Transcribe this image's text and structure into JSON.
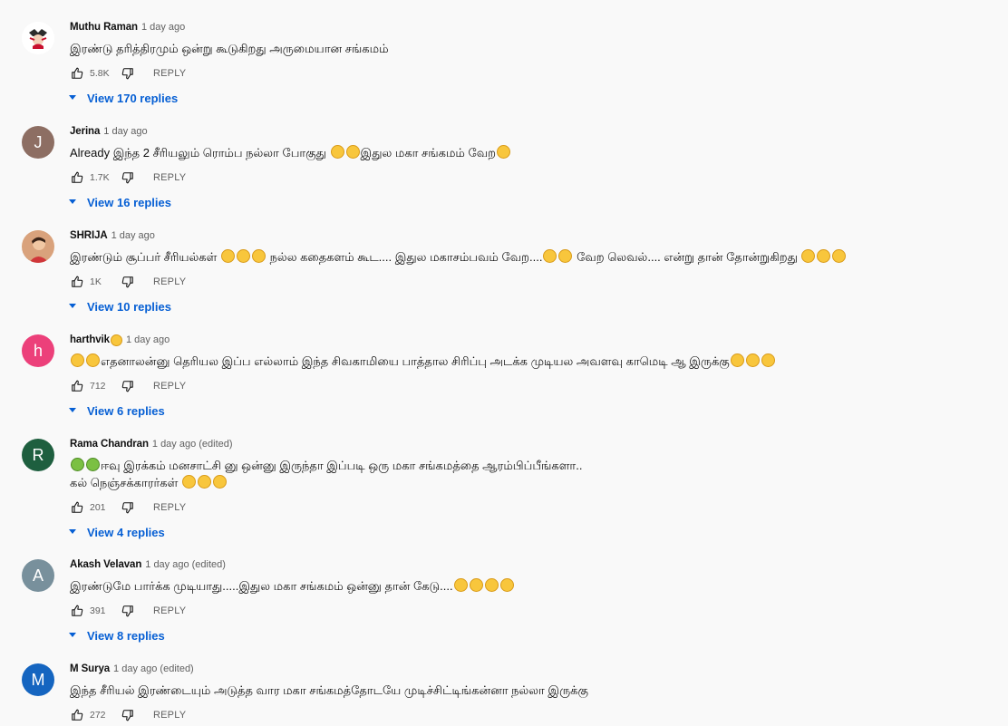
{
  "colors": {
    "background": "#f9f9f9",
    "link_blue": "#065fd4",
    "secondary_text": "#606060"
  },
  "comments": [
    {
      "author": "Muthu Raman",
      "time": "1 day ago",
      "avatar": {
        "type": "photo",
        "letter": ""
      },
      "text_line_1": "இரண்டு தரித்திரமும் ஒன்று கூடுகிறது அருமையான சங்கமம்",
      "likes": "5.8K",
      "reply_label": "REPLY",
      "replies_label": "View 170 replies"
    },
    {
      "author": "Jerina",
      "time": "1 day ago",
      "avatar": {
        "type": "letter",
        "letter": "J",
        "color": "#8d6e63"
      },
      "text_line_1": "Already இந்த 2 சீரியலும் ரொம்ப நல்லா போகுது",
      "text_line_1_b": "இதுல மகா சங்கமம் வேற",
      "likes": "1.7K",
      "reply_label": "REPLY",
      "replies_label": "View 16 replies"
    },
    {
      "author": "SHRIJA",
      "time": "1 day ago",
      "avatar": {
        "type": "photo",
        "letter": ""
      },
      "text_line_1": "இரண்டும் சூப்பர் சீரியல்கள்",
      "text_line_1_b": "நல்ல கதைகளம் கூட.... இதுல மகாசம்பவம் வேற....",
      "text_line_1_c": "வேற லெவல்.... என்று தான் தோன்றுகிறது",
      "likes": "1K",
      "reply_label": "REPLY",
      "replies_label": "View 10 replies"
    },
    {
      "author": "harthvik",
      "time": "1 day ago",
      "avatar": {
        "type": "letter",
        "letter": "h",
        "color": "#ec407a"
      },
      "text_line_1": "எதனாலன்னு தெரியல இப்ப எல்லாம் இந்த சிவகாமியை பாத்தால சிரிப்பு அடக்க முடியல அவளவு காமெடி ஆ இருக்கு",
      "likes": "712",
      "reply_label": "REPLY",
      "replies_label": "View 6 replies"
    },
    {
      "author": "Rama Chandran",
      "time": "1 day ago (edited)",
      "avatar": {
        "type": "letter",
        "letter": "R",
        "color": "#1e5f3f"
      },
      "text_line_1": "ஈவு இரக்கம் மனசாட்சி னு ஒன்னு இருந்தா இப்படி ஒரு மகா சங்கமத்தை ஆரம்பிப்பீங்களா..",
      "text_line_2": "கல் நெஞ்சக்காரர்கள்",
      "likes": "201",
      "reply_label": "REPLY",
      "replies_label": "View 4 replies"
    },
    {
      "author": "Akash Velavan",
      "time": "1 day ago (edited)",
      "avatar": {
        "type": "letter",
        "letter": "A",
        "color": "#78909c"
      },
      "text_line_1": "இரண்டுமே பார்க்க முடியாது.....இதுல மகா சங்கமம் ஒன்னு தான் கேடு....",
      "likes": "391",
      "reply_label": "REPLY",
      "replies_label": "View 8 replies"
    },
    {
      "author": "M Surya",
      "time": "1 day ago (edited)",
      "avatar": {
        "type": "letter",
        "letter": "M",
        "color": "#1565c0"
      },
      "text_line_1": "இந்த சீரியல் இரண்டையும் அடுத்த வார மகா சங்கமத்தோடயே முடிச்சிட்டிங்கன்னா நல்லா இருக்கு",
      "likes": "272",
      "reply_label": "REPLY"
    }
  ]
}
